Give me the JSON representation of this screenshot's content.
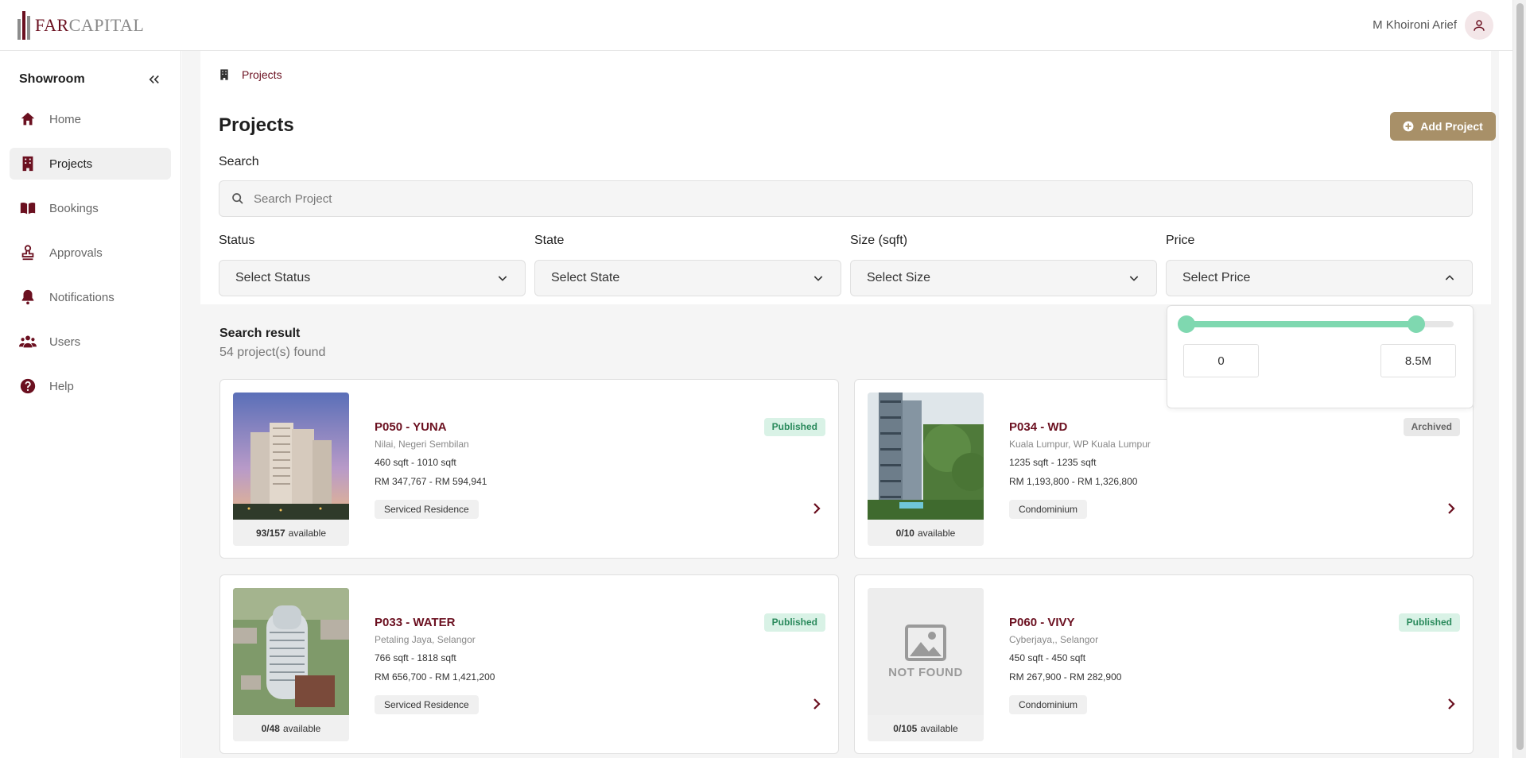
{
  "brand": {
    "far": "FAR",
    "capital": "CAPITAL"
  },
  "user": {
    "name": "M Khoironi Arief"
  },
  "sidebar": {
    "title": "Showroom",
    "items": [
      {
        "label": "Home",
        "icon": "home-icon"
      },
      {
        "label": "Projects",
        "icon": "building-icon",
        "active": true
      },
      {
        "label": "Bookings",
        "icon": "book-icon"
      },
      {
        "label": "Approvals",
        "icon": "stamp-icon"
      },
      {
        "label": "Notifications",
        "icon": "bell-icon"
      },
      {
        "label": "Users",
        "icon": "users-icon"
      },
      {
        "label": "Help",
        "icon": "help-icon"
      }
    ]
  },
  "breadcrumb": {
    "label": "Projects"
  },
  "page": {
    "title": "Projects",
    "add_button": "Add Project"
  },
  "search": {
    "label": "Search",
    "placeholder": "Search Project"
  },
  "filters": {
    "status": {
      "label": "Status",
      "value": "Select Status"
    },
    "state": {
      "label": "State",
      "value": "Select State"
    },
    "size": {
      "label": "Size (sqft)",
      "value": "Select Size"
    },
    "price": {
      "label": "Price",
      "value": "Select Price"
    }
  },
  "price_range": {
    "min": "0",
    "max": "8.5M",
    "low_fraction": 0.0,
    "high_fraction": 0.86
  },
  "results": {
    "title": "Search result",
    "count": "54 project(s) found"
  },
  "colors": {
    "brand": "#6b1020",
    "accent": "#a89068",
    "published": "#2a8a5c",
    "slider": "#7fd8b0"
  },
  "projects": [
    {
      "name": "P050 - YUNA",
      "location": "Nilai, Negeri Sembilan",
      "size": "460 sqft - 1010 sqft",
      "price": "RM 347,767 - RM 594,941",
      "type": "Serviced Residence",
      "status": "Published",
      "available": "93/157",
      "available_suffix": "available"
    },
    {
      "name": "P034 - WD",
      "location": "Kuala Lumpur, WP Kuala Lumpur",
      "size": "1235 sqft - 1235 sqft",
      "price": "RM 1,193,800 - RM 1,326,800",
      "type": "Condominium",
      "status": "Archived",
      "available": "0/10",
      "available_suffix": "available"
    },
    {
      "name": "P033 - WATER",
      "location": "Petaling Jaya, Selangor",
      "size": "766 sqft - 1818 sqft",
      "price": "RM 656,700 - RM 1,421,200",
      "type": "Serviced Residence",
      "status": "Published",
      "available": "0/48",
      "available_suffix": "available"
    },
    {
      "name": "P060 - VIVY",
      "location": "Cyberjaya,, Selangor",
      "size": "450 sqft - 450 sqft",
      "price": "RM 267,900 - RM 282,900",
      "type": "Condominium",
      "status": "Published",
      "available": "0/105",
      "available_suffix": "available",
      "image_placeholder": "NOT FOUND"
    }
  ]
}
